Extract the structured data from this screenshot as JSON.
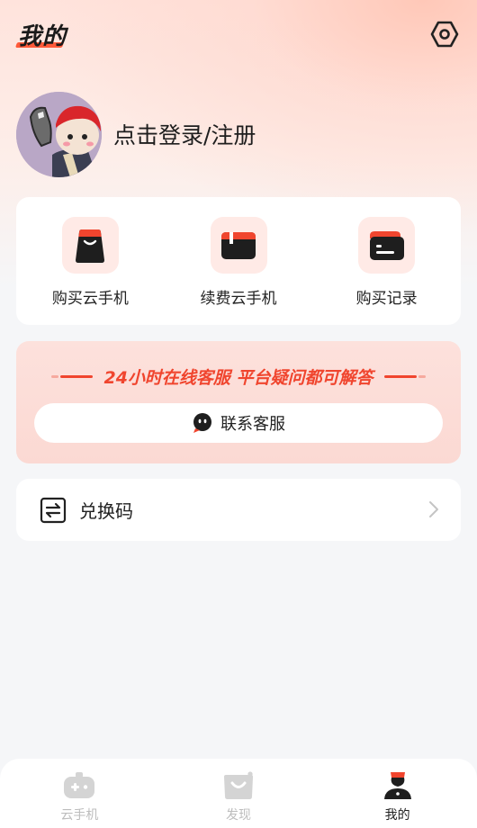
{
  "header": {
    "title": "我的",
    "settings_icon": "hexagon-settings-icon"
  },
  "profile": {
    "login_label": "点击登录/注册"
  },
  "actions": [
    {
      "label": "购买云手机",
      "icon": "shopping-bag-icon"
    },
    {
      "label": "续费云手机",
      "icon": "renew-card-icon"
    },
    {
      "label": "购买记录",
      "icon": "wallet-record-icon"
    }
  ],
  "service": {
    "headline": "24小时在线客服 平台疑问都可解答",
    "contact_label": "联系客服"
  },
  "redeem": {
    "label": "兑换码"
  },
  "tabbar": [
    {
      "label": "云手机",
      "active": false
    },
    {
      "label": "发现",
      "active": false
    },
    {
      "label": "我的",
      "active": true
    }
  ],
  "colors": {
    "accent": "#f0452e",
    "tab_inactive": "#bdbdbd",
    "tab_active": "#1e1e1e"
  }
}
